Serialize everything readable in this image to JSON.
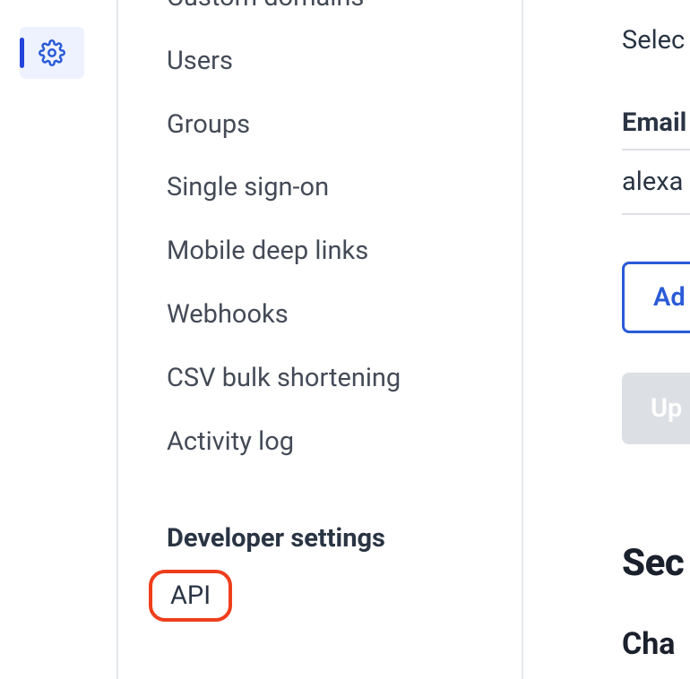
{
  "rail": {
    "active_icon": "settings"
  },
  "sidebar": {
    "items": [
      {
        "label": "Custom domains"
      },
      {
        "label": "Users"
      },
      {
        "label": "Groups"
      },
      {
        "label": "Single sign-on"
      },
      {
        "label": "Mobile deep links"
      },
      {
        "label": "Webhooks"
      },
      {
        "label": "CSV bulk shortening"
      },
      {
        "label": "Activity log"
      }
    ],
    "developer_heading": "Developer settings",
    "developer_items": [
      {
        "label": "API"
      }
    ]
  },
  "right": {
    "select_text": "Selec",
    "email_label": "Email",
    "email_value": "alexa",
    "add_button": "Ad",
    "update_button": "Up",
    "security_heading": "Sec",
    "change_heading": "Cha"
  }
}
